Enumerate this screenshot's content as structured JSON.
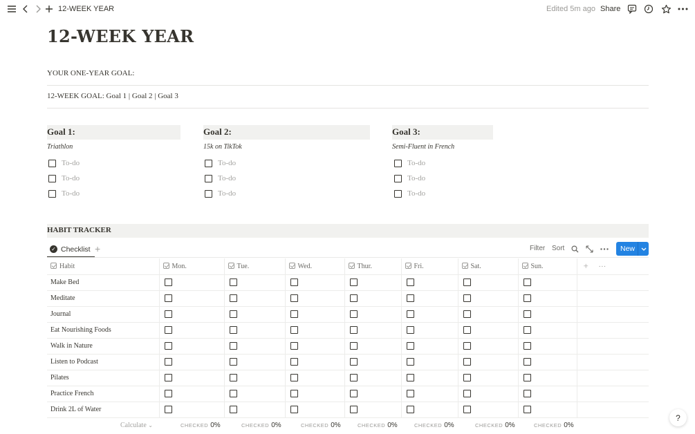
{
  "topbar": {
    "breadcrumb": "12-WEEK YEAR",
    "edited": "Edited 5m ago",
    "share": "Share"
  },
  "page": {
    "title": "12-WEEK YEAR",
    "one_year_goal": "YOUR ONE-YEAR GOAL:",
    "twelve_week_goal": "12-WEEK GOAL: Goal 1 | Goal 2 |  Goal 3"
  },
  "goals": [
    {
      "heading": "Goal 1:",
      "subtitle": "Triathlon",
      "todos": [
        "To-do",
        "To-do",
        "To-do"
      ]
    },
    {
      "heading": "Goal 2:",
      "subtitle": "15k on TikTok",
      "todos": [
        "To-do",
        "To-do",
        "To-do"
      ]
    },
    {
      "heading": "Goal 3:",
      "subtitle": "Semi-Fluent in French",
      "todos": [
        "To-do",
        "To-do",
        "To-do"
      ]
    }
  ],
  "habit_tracker": {
    "banner": "HABIT TRACKER",
    "view_tab": "Checklist",
    "filter": "Filter",
    "sort": "Sort",
    "new_button": "New",
    "columns": [
      "Habit",
      "Mon.",
      "Tue.",
      "Wed.",
      "Thur.",
      "Fri.",
      "Sat.",
      "Sun."
    ],
    "rows": [
      "Make Bed",
      "Meditate",
      "Journal",
      "Eat Nourishing Foods",
      "Walk in Nature",
      "Listen to Podcast",
      "Pilates",
      "Practice French",
      "Drink 2L of Water"
    ],
    "checked": [
      [
        false,
        false,
        false,
        false,
        false,
        false,
        false
      ],
      [
        false,
        false,
        false,
        false,
        false,
        false,
        false
      ],
      [
        false,
        false,
        false,
        false,
        false,
        false,
        false
      ],
      [
        false,
        false,
        false,
        false,
        false,
        false,
        false
      ],
      [
        false,
        false,
        false,
        false,
        false,
        false,
        false
      ],
      [
        false,
        false,
        false,
        false,
        false,
        false,
        false
      ],
      [
        false,
        false,
        false,
        false,
        false,
        false,
        false
      ],
      [
        false,
        false,
        false,
        false,
        false,
        false,
        false
      ],
      [
        false,
        false,
        false,
        false,
        false,
        false,
        false
      ]
    ],
    "calculate": "Calculate",
    "checked_label": "CHECKED",
    "checked_values": [
      "0%",
      "0%",
      "0%",
      "0%",
      "0%",
      "0%",
      "0%"
    ]
  },
  "help": "?",
  "icons": [
    "menu-icon",
    "back-icon",
    "forward-icon",
    "plus-icon",
    "comment-icon",
    "clock-icon",
    "star-icon",
    "more-icon",
    "search-icon",
    "expand-icon"
  ],
  "colors": {
    "accent": "#2383e2",
    "text": "#37352f",
    "muted": "#9b9a97",
    "banner_bg": "#f1f1ef"
  }
}
